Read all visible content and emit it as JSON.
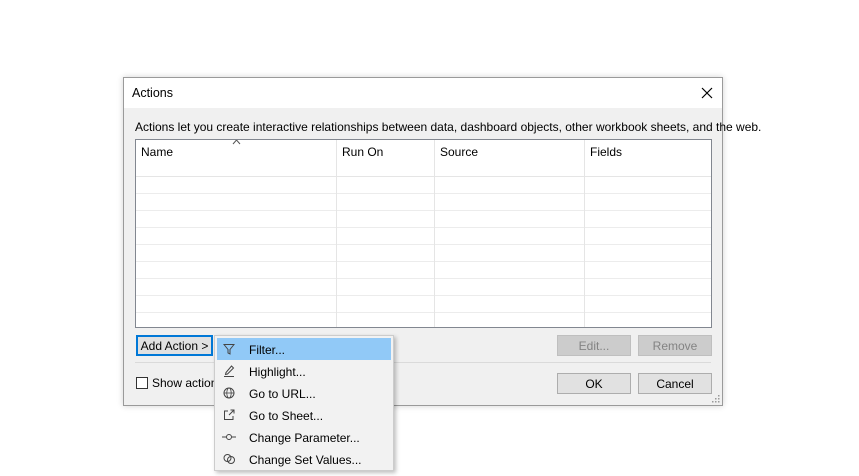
{
  "dialog": {
    "title": "Actions",
    "description": "Actions let you create interactive relationships between data, dashboard objects, other workbook sheets, and the web.",
    "table": {
      "columns": [
        "Name",
        "Run On",
        "Source",
        "Fields"
      ],
      "empty_rows": 9
    },
    "buttons": {
      "add_action": "Add Action >",
      "edit": "Edit...",
      "remove": "Remove",
      "ok": "OK",
      "cancel": "Cancel"
    },
    "show_actions_label": "Show actions",
    "show_actions_checked": false
  },
  "dropdown_menu": {
    "items": [
      {
        "label": "Filter...",
        "icon": "filter-icon",
        "highlighted": true
      },
      {
        "label": "Highlight...",
        "icon": "highlight-icon",
        "highlighted": false
      },
      {
        "label": "Go to URL...",
        "icon": "globe-icon",
        "highlighted": false
      },
      {
        "label": "Go to Sheet...",
        "icon": "go-to-sheet-icon",
        "highlighted": false
      },
      {
        "label": "Change Parameter...",
        "icon": "parameter-icon",
        "highlighted": false
      },
      {
        "label": "Change Set Values...",
        "icon": "set-values-icon",
        "highlighted": false
      }
    ]
  },
  "colors": {
    "accent": "#0078d7",
    "menu_highlight": "#91c9f7",
    "dialog_background": "#f0f0f0"
  }
}
